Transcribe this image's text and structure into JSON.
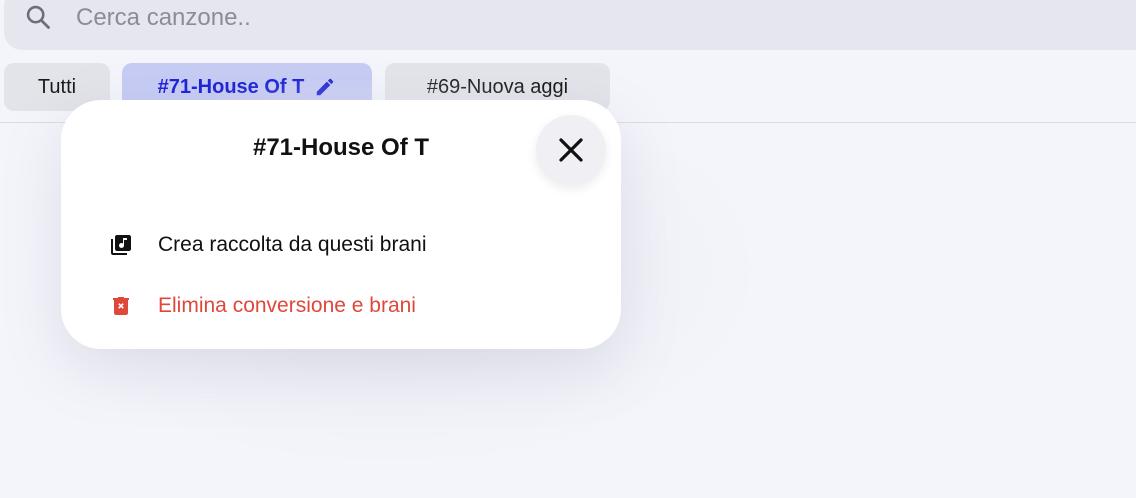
{
  "search": {
    "placeholder": "Cerca canzone..",
    "value": "",
    "icon": "search-icon"
  },
  "tabs": [
    {
      "label": "Tutti",
      "active": false
    },
    {
      "label": "#71-House Of T",
      "active": true,
      "icon": "pencil-icon"
    },
    {
      "label": "#69-Nuova aggi",
      "active": false
    }
  ],
  "popover": {
    "title": "#71-House Of T",
    "close_icon": "close-icon",
    "items": [
      {
        "label": "Crea raccolta da questi brani",
        "icon": "library-music-icon"
      },
      {
        "label": "Elimina conversione e brani",
        "icon": "trash-icon"
      }
    ]
  },
  "colors": {
    "accent": "#1f25d8",
    "active_tab_bg": "#c7ccf4",
    "danger": "#e0473b",
    "background": "#f4f5fb"
  }
}
